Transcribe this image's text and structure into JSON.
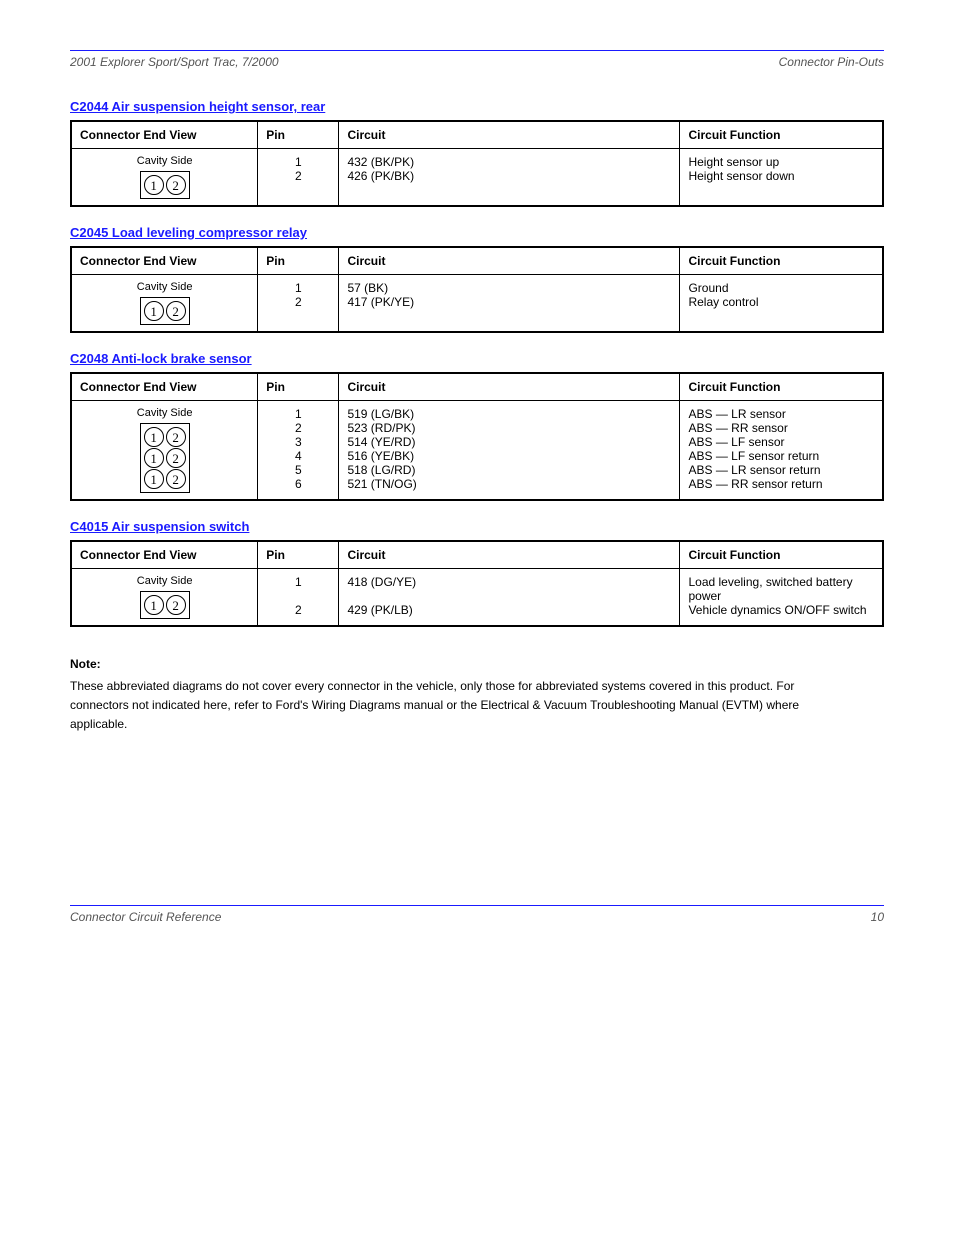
{
  "header": {
    "left": "2001 Explorer Sport/Sport Trac, 7/2000",
    "right": "Connector Pin-Outs"
  },
  "footer": {
    "left": "Connector Circuit Reference",
    "right": "10"
  },
  "sections": [
    {
      "title": "C2044 Air suspension height sensor, rear",
      "headers": [
        "Connector End View",
        "Pin",
        "Circuit",
        "Circuit Function"
      ],
      "rows": [
        {
          "cav_rows": 1,
          "cav_label": "Cavity Side",
          "pin": "1\n2",
          "circuit": "432 (BK/PK)\n426 (PK/BK)",
          "func": "Height sensor up\nHeight sensor down"
        }
      ]
    },
    {
      "title": "C2045 Load leveling compressor relay",
      "headers": [
        "Connector End View",
        "Pin",
        "Circuit",
        "Circuit Function"
      ],
      "rows": [
        {
          "cav_rows": 1,
          "cav_label": "Cavity Side",
          "pin": "1\n2",
          "circuit": "57 (BK)\n417 (PK/YE)",
          "func": "Ground\nRelay control"
        }
      ]
    },
    {
      "title": "C2048 Anti-lock brake sensor",
      "headers": [
        "Connector End View",
        "Pin",
        "Circuit",
        "Circuit Function"
      ],
      "rows": [
        {
          "cav_rows": 3,
          "cav_label": "Cavity Side",
          "pin": "1\n2\n3\n4\n5\n6",
          "circuit": "519 (LG/BK)\n523 (RD/PK)\n514 (YE/RD)\n516 (YE/BK)\n518 (LG/RD)\n521 (TN/OG)",
          "func": "ABS — LR sensor\nABS — RR sensor\nABS — LF sensor\nABS — LF sensor return\nABS — LR sensor return\nABS — RR sensor return"
        }
      ]
    },
    {
      "title": "C4015 Air suspension switch",
      "headers": [
        "Connector End View",
        "Pin",
        "Circuit",
        "Circuit Function"
      ],
      "rows": [
        {
          "cav_rows": 1,
          "cav_label": "Cavity Side",
          "pin": "1\n\n2",
          "circuit": "418 (DG/YE)\n\n429 (PK/LB)",
          "func": "Load leveling, switched battery power\nVehicle dynamics ON/OFF switch"
        }
      ]
    }
  ],
  "note": {
    "title": "Note:",
    "body": "These abbreviated diagrams do not cover every connector in the vehicle, only those for abbreviated systems covered in this product. For connectors not indicated here, refer to Ford's Wiring Diagrams manual or the Electrical & Vacuum Troubleshooting Manual (EVTM) where applicable."
  }
}
